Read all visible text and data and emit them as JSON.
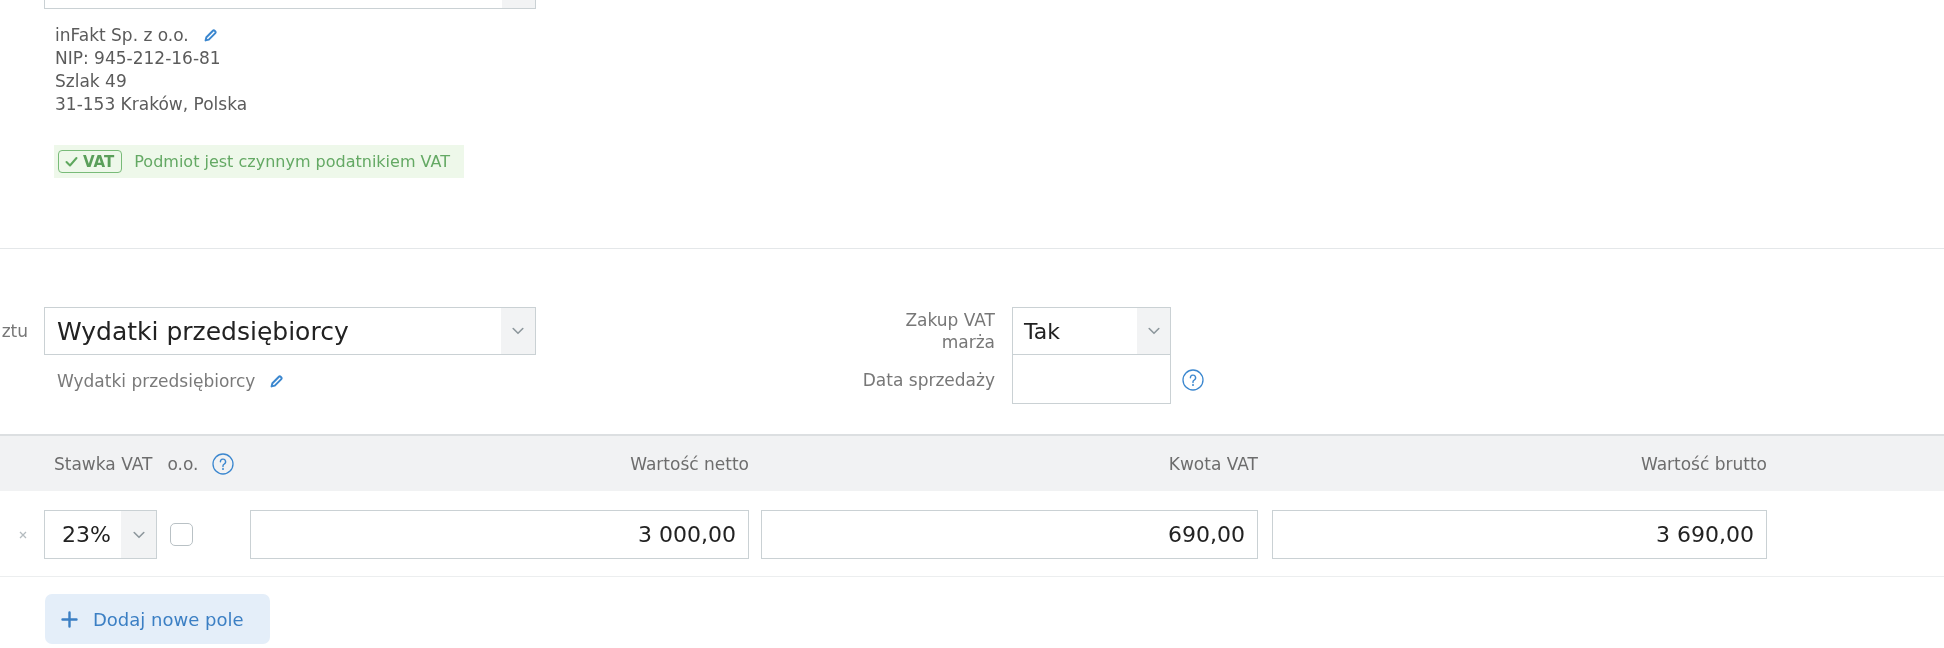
{
  "contractor": {
    "name": "inFakt Sp. z o.o.",
    "tax_id": "NIP: 945-212-16-81",
    "street": "Szlak 49",
    "city": "31-153 Kraków, Polska",
    "vat_status": {
      "badge": "VAT",
      "message": "Podmiot jest czynnym podatnikiem VAT"
    }
  },
  "category": {
    "label": "ztu",
    "value": "Wydatki przedsiębiorcy",
    "description": "Wydatki przedsiębiorcy"
  },
  "vat_margin": {
    "label": "Zakup VAT marża",
    "value": "Tak"
  },
  "sale_date": {
    "label": "Data sprzedaży",
    "help": true
  },
  "table": {
    "columns": [
      {
        "label": "Stawka VAT",
        "kind": "select",
        "help": false
      },
      {
        "label": "o.o.",
        "kind": "checkbox",
        "help": true
      },
      {
        "label": "Wartość netto",
        "kind": "amount",
        "help": false
      },
      {
        "label": "Kwota VAT",
        "kind": "amount",
        "help": false
      },
      {
        "label": "Wartość brutto",
        "kind": "amount",
        "help": false
      }
    ],
    "rows": [
      {
        "cells": [
          {
            "kind": "select",
            "value": "23%"
          },
          {
            "kind": "checkbox",
            "checked": false
          },
          {
            "kind": "amount",
            "value": "3 000,00"
          },
          {
            "kind": "amount",
            "value": "690,00"
          },
          {
            "kind": "amount",
            "value": "3 690,00"
          }
        ]
      }
    ]
  },
  "add_button": {
    "label": "Dodaj nowe pole"
  }
}
